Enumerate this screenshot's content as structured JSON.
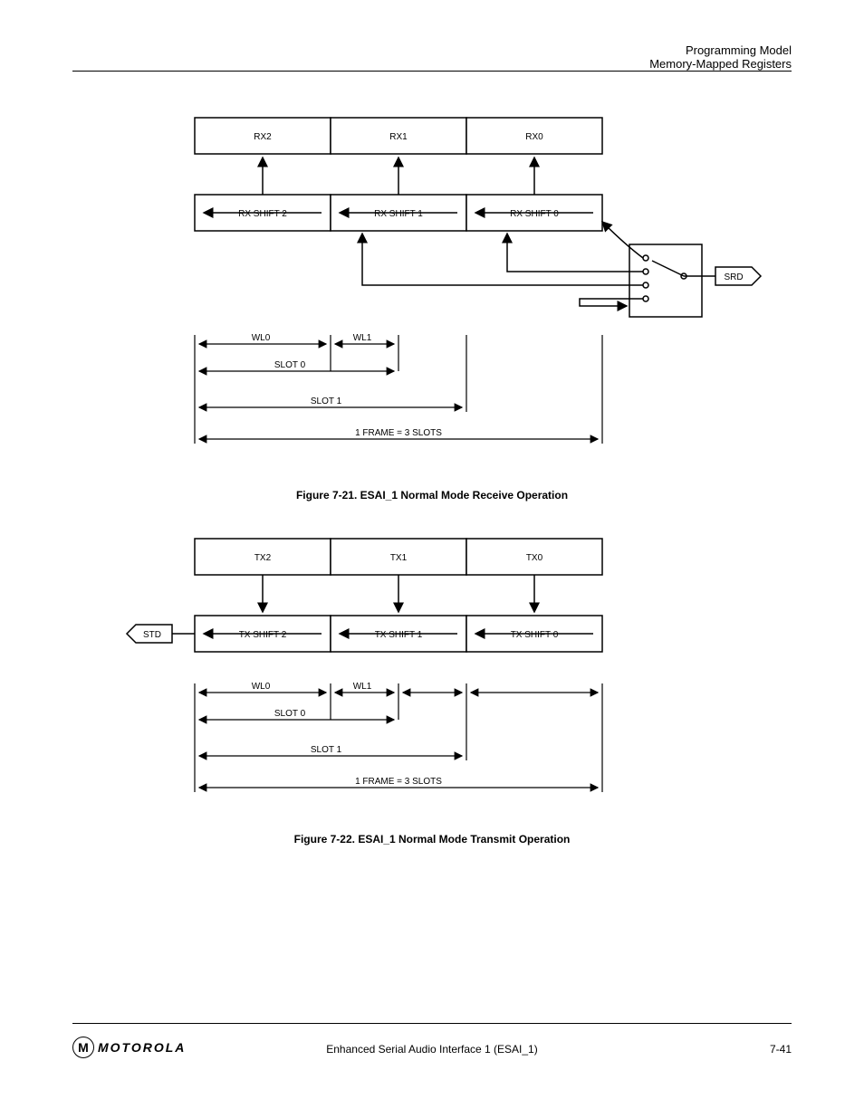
{
  "header": {
    "section": "Programming Model",
    "subsection": "Memory-Mapped Registers"
  },
  "diagram_rx": {
    "fifo": {
      "a": "RX2",
      "b": "RX1",
      "c": "RX0"
    },
    "shift": {
      "a": "RX SHIFT 2",
      "b": "RX SHIFT 1",
      "c": "RX SHIFT 0"
    },
    "input_pin": "SRD",
    "dims": {
      "wl0": "WL0",
      "wl1": "WL1",
      "slot0": "SLOT 0",
      "slot1": "SLOT 1",
      "frame": "1 FRAME = 3 SLOTS"
    }
  },
  "diagram_tx": {
    "fifo": {
      "a": "TX2",
      "b": "TX1",
      "c": "TX0"
    },
    "shift": {
      "a": "TX SHIFT 2",
      "b": "TX SHIFT 1",
      "c": "TX SHIFT 0"
    },
    "output_pin": "STD",
    "dims": {
      "wl0": "WL0",
      "wl1": "WL1",
      "slot0": "SLOT 0",
      "slot1": "SLOT 1",
      "frame": "1 FRAME = 3 SLOTS"
    }
  },
  "captions": {
    "fig1": "Figure 7-21.   ESAI_1 Normal Mode Receive Operation",
    "fig2": "Figure 7-22.   ESAI_1 Normal Mode Transmit Operation"
  },
  "footer": {
    "left": "",
    "center": "Enhanced Serial Audio Interface 1 (ESAI_1)",
    "right": "7-41"
  }
}
